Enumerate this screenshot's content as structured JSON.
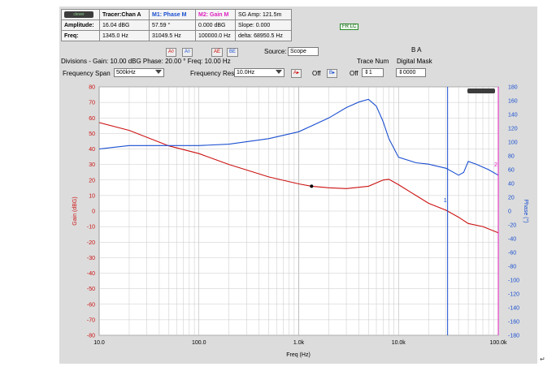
{
  "info_table": {
    "header": [
      "",
      "Tracer:Chan A",
      "M1: Phase M",
      "M2: Gain M",
      "SG Amp: 121.5m"
    ],
    "rows": [
      {
        "label": "Amplitude:",
        "tracer": "16.04 dBG",
        "m1": "57.59 °",
        "m2": "0.000 dBG",
        "extra": "Slope: 0.000"
      },
      {
        "label": "Freq:",
        "tracer": "1345.0 Hz",
        "m1": "31049.5 Hz",
        "m2": "100000.0 Hz",
        "extra": "delta: 68950.5 Hz"
      }
    ],
    "logo_text": "clever",
    "lc_button": "FR LC"
  },
  "controls": {
    "divisions": "Divisions -  Gain: 10.00 dBG   Phase: 20.00 °   Freq: 10.00 Hz",
    "source_label": "Source:",
    "source_value": "Scope",
    "trace_num_label": "Trace Num",
    "ba_label": "B  A",
    "digital_mask_label": "Digital Mask",
    "freq_span_label": "Frequency Span",
    "freq_span_value": "500kHz",
    "freq_res_label": "Frequency Res",
    "freq_res_value": "10.0Hz",
    "off1": "Off",
    "off2": "Off",
    "trace_num_value": "1",
    "digital_mask_value": "0000"
  },
  "colors": {
    "gain": "#cc1111",
    "phase": "#1a4fd0",
    "marker_m1": "#1a4fd0",
    "marker_m2": "#e020c0",
    "grid": "#c8c8c8"
  },
  "chart_data": {
    "type": "line",
    "xlabel": "Freq (Hz)",
    "ylabel": "Gain (dBG)",
    "y2label": "Phase (°)",
    "xscale": "log",
    "xlim": [
      10,
      100000
    ],
    "ylim": [
      -80,
      80
    ],
    "y2lim": [
      -180,
      180
    ],
    "x_tick_labels": [
      "10.0",
      "100.0",
      "1.0k",
      "10.0k",
      "100.0k"
    ],
    "y_tick_labels": [
      "80",
      "70",
      "60",
      "50",
      "40",
      "30",
      "20",
      "10",
      "0",
      "-10",
      "-20",
      "-30",
      "-40",
      "-50",
      "-60",
      "-70",
      "-80"
    ],
    "y2_tick_labels": [
      "180",
      "160",
      "140",
      "120",
      "100",
      "80",
      "60",
      "40",
      "20",
      "0",
      "-20",
      "-40",
      "-60",
      "-80",
      "-100",
      "-120",
      "-140",
      "-160",
      "-180"
    ],
    "grid": true,
    "series": [
      {
        "axis": "left",
        "color": "#cc1111",
        "x": [
          10,
          20,
          50,
          100,
          200,
          500,
          1000,
          1345,
          2000,
          3000,
          5000,
          7000,
          8000,
          10000,
          15000,
          20000,
          30000,
          40000,
          50000,
          70000,
          100000
        ],
        "y": [
          57,
          52,
          42,
          37,
          30,
          22,
          17.5,
          16,
          15,
          14.5,
          16,
          20,
          20.5,
          17,
          10,
          5,
          0.5,
          -4,
          -8,
          -10,
          -14
        ]
      },
      {
        "axis": "right",
        "color": "#1a4fd0",
        "x": [
          10,
          20,
          50,
          100,
          200,
          500,
          1000,
          2000,
          3000,
          4000,
          5000,
          6000,
          7000,
          8000,
          10000,
          15000,
          20000,
          30000,
          40000,
          45000,
          50000,
          60000,
          80000,
          100000
        ],
        "y": [
          90,
          95,
          95,
          95,
          97,
          105,
          115,
          135,
          150,
          158,
          162,
          152,
          130,
          105,
          78,
          70,
          68,
          62,
          52,
          56,
          72,
          68,
          60,
          52
        ]
      }
    ],
    "markers": [
      {
        "label": "1",
        "x": 31049.5,
        "color": "#1a4fd0"
      },
      {
        "label": "2",
        "x": 100000,
        "color": "#e020c0"
      }
    ],
    "tracer_point": {
      "x": 1345,
      "y": 16.04
    }
  }
}
